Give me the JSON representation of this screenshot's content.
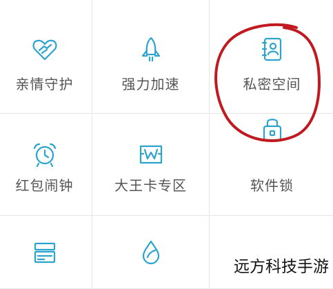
{
  "grid": {
    "items": [
      {
        "label": "亲情守护",
        "icon": "heart-hands-icon"
      },
      {
        "label": "强力加速",
        "icon": "rocket-icon"
      },
      {
        "label": "私密空间",
        "icon": "contact-book-icon"
      },
      {
        "label": "红包闹钟",
        "icon": "alarm-clock-icon"
      },
      {
        "label": "大王卡专区",
        "icon": "card-zone-icon"
      },
      {
        "label": "软件锁",
        "icon": "lock-icon"
      },
      {
        "label": "",
        "icon": "storage-icon"
      },
      {
        "label": "",
        "icon": "water-drop-icon"
      },
      {
        "label": "",
        "icon": ""
      }
    ]
  },
  "annotation": {
    "color": "#c0191f"
  },
  "watermark": {
    "text": "远方科技手游"
  },
  "colors": {
    "icon": "#2aa3cf",
    "label": "#555555",
    "border": "#e6e6e6"
  }
}
